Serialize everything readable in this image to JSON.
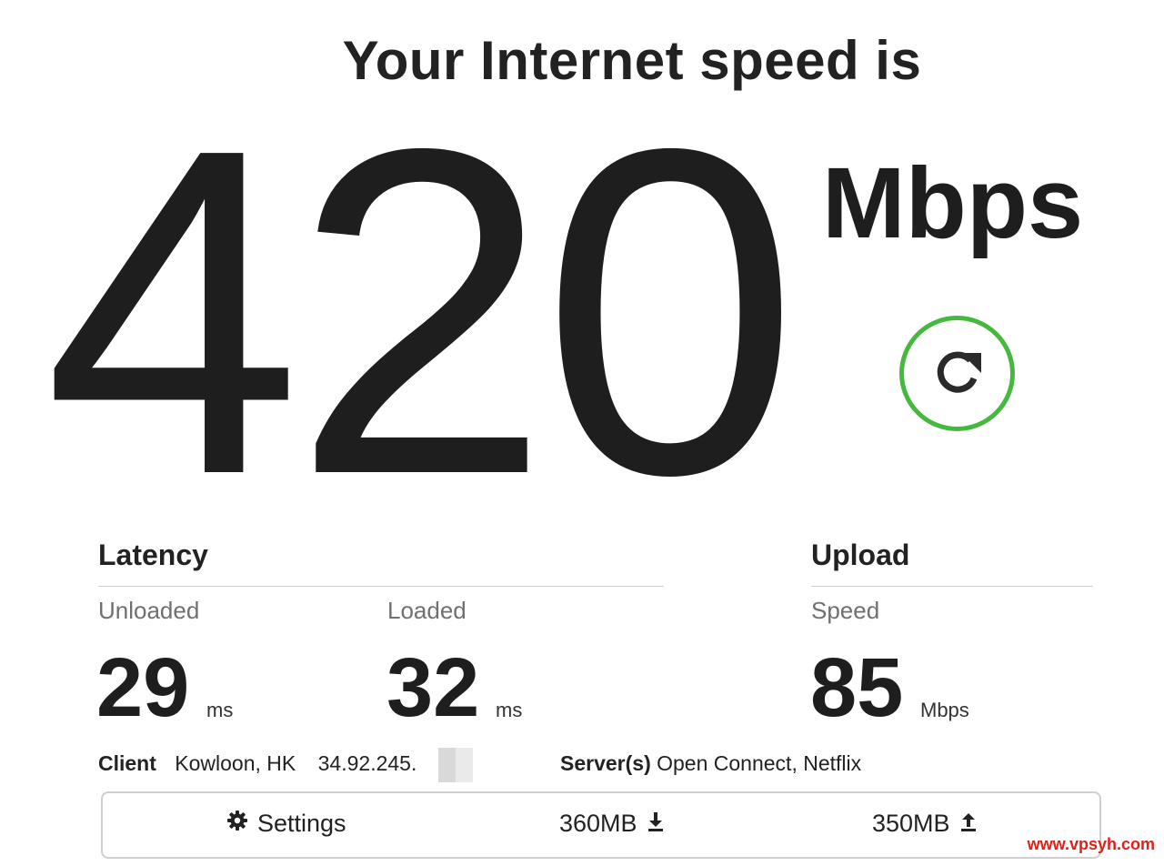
{
  "header": {
    "title": "Your Internet speed is"
  },
  "speed": {
    "value": "420",
    "units": "Mbps"
  },
  "latency": {
    "title": "Latency",
    "unloaded": {
      "label": "Unloaded",
      "value": "29",
      "unit": "ms"
    },
    "loaded": {
      "label": "Loaded",
      "value": "32",
      "unit": "ms"
    }
  },
  "upload": {
    "title": "Upload",
    "speed": {
      "label": "Speed",
      "value": "85",
      "unit": "Mbps"
    }
  },
  "client": {
    "label": "Client",
    "location": "Kowloon, HK",
    "ip": "34.92.245."
  },
  "server": {
    "label": "Server(s)",
    "value": "Open Connect, Netflix"
  },
  "settings_bar": {
    "settings_label": "Settings",
    "download_size": "360MB",
    "upload_size": "350MB"
  },
  "watermark": "www.vpsyh.com",
  "colors": {
    "accent": "#45b93d",
    "text": "#1e1e1e",
    "muted": "#707070",
    "watermark": "#e0201b"
  },
  "icons": {
    "refresh": "refresh-icon",
    "settings": "gear-icon",
    "download": "download-arrow-icon",
    "upload": "upload-arrow-icon"
  }
}
